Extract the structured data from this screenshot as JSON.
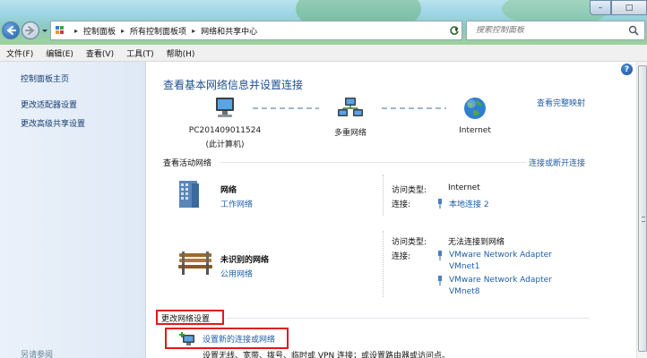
{
  "window": {
    "minimize_label": "–",
    "maximize_label": "□"
  },
  "address_bar": {
    "crumbs": [
      "控制面板",
      "所有控制面板项",
      "网络和共享中心"
    ],
    "separator": "▸",
    "dropdown": "▾"
  },
  "search": {
    "placeholder": "搜索控制面板"
  },
  "menu": {
    "items": [
      "文件(F)",
      "编辑(E)",
      "查看(V)",
      "工具(T)",
      "帮助(H)"
    ]
  },
  "sidebar": {
    "items": [
      "控制面板主页",
      "更改适配器设置",
      "更改高级共享设置"
    ],
    "see_also": "另请参阅"
  },
  "main": {
    "title": "查看基本网络信息并设置连接",
    "full_map_link": "查看完整映射",
    "help_label": "?",
    "map_nodes": [
      {
        "name": "PC201409011524",
        "subtitle": "(此计算机)",
        "icon": "computer-icon"
      },
      {
        "name": "多重网络",
        "icon": "multi-network-icon"
      },
      {
        "name": "Internet",
        "icon": "globe-icon"
      }
    ],
    "active_networks": {
      "title": "查看活动网络",
      "connect_link": "连接或断开连接",
      "networks": [
        {
          "name": "网络",
          "type": "工作网络",
          "icon": "building-icon",
          "access_label": "访问类型:",
          "access_value": "Internet",
          "conn_label": "连接:",
          "connections": [
            "本地连接 2"
          ]
        },
        {
          "name": "未识别的网络",
          "type": "公用网络",
          "icon": "park-bench-icon",
          "access_label": "访问类型:",
          "access_value": "无法连接到网络",
          "conn_label": "连接:",
          "connections": [
            "VMware Network Adapter VMnet1",
            "VMware Network Adapter VMnet8"
          ]
        }
      ]
    },
    "change_settings": {
      "title": "更改网络设置",
      "setup_link": "设置新的连接或网络",
      "setup_desc": "设置无线、宽带、拨号、临时或 VPN 连接；或设置路由器或访问点。"
    }
  },
  "colors": {
    "link": "#1f5ea8",
    "title": "#1d4f91",
    "highlight_box": "#e1191b"
  }
}
